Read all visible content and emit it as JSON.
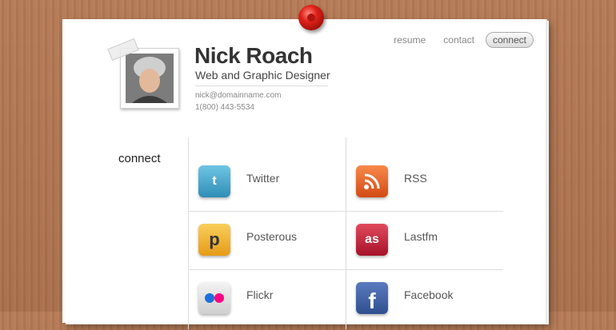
{
  "nav": {
    "items": [
      {
        "label": "resume"
      },
      {
        "label": "contact"
      },
      {
        "label": "connect"
      }
    ]
  },
  "profile": {
    "name": "Nick Roach",
    "role": "Web and Graphic Designer",
    "email": "nick@domainname.com",
    "phone": "1(800) 443-5534"
  },
  "connect": {
    "heading": "connect",
    "links": [
      {
        "label": "Twitter",
        "icon": "twitter-icon",
        "color": "#4fa7c9"
      },
      {
        "label": "RSS",
        "icon": "rss-icon",
        "color": "#e9672b"
      },
      {
        "label": "Posterous",
        "icon": "posterous-icon",
        "color": "#f2b43d"
      },
      {
        "label": "Lastfm",
        "icon": "lastfm-icon",
        "color": "#c21f33"
      },
      {
        "label": "Flickr",
        "icon": "flickr-icon",
        "color": "#d8d8d8"
      },
      {
        "label": "Facebook",
        "icon": "facebook-icon",
        "color": "#3b5b98"
      }
    ]
  }
}
